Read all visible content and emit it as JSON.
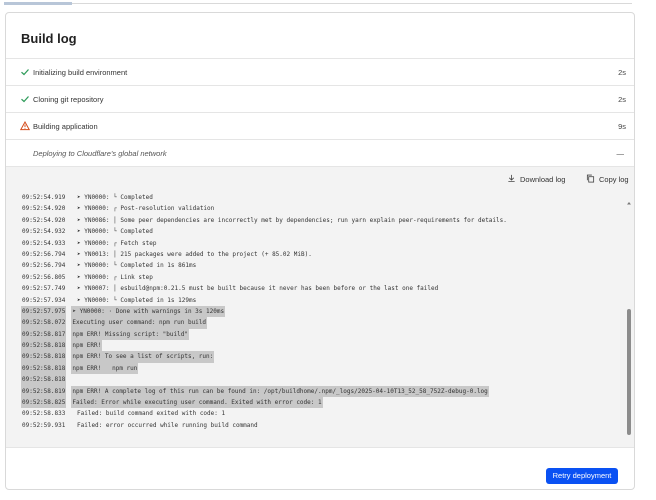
{
  "title": "Build log",
  "steps": [
    {
      "label": "Initializing build environment",
      "duration": "2s",
      "status": "success"
    },
    {
      "label": "Cloning git repository",
      "duration": "2s",
      "status": "success"
    },
    {
      "label": "Building application",
      "duration": "9s",
      "status": "warning"
    },
    {
      "label": "Deploying to Cloudflare's global network",
      "duration": "—",
      "status": "pending"
    }
  ],
  "toolbar": {
    "download_label": "Download log",
    "copy_label": "Copy log"
  },
  "log": [
    {
      "ts": "09:52:54.919",
      "msg": "➤ YN0000: └ Completed",
      "hl": false
    },
    {
      "ts": "09:52:54.920",
      "msg": "➤ YN0000: ┌ Post-resolution validation",
      "hl": false
    },
    {
      "ts": "09:52:54.920",
      "msg": "➤ YN0086: │ Some peer dependencies are incorrectly met by dependencies; run yarn explain peer-requirements for details.",
      "hl": false
    },
    {
      "ts": "09:52:54.932",
      "msg": "➤ YN0000: └ Completed",
      "hl": false
    },
    {
      "ts": "09:52:54.933",
      "msg": "➤ YN0000: ┌ Fetch step",
      "hl": false
    },
    {
      "ts": "09:52:56.794",
      "msg": "➤ YN0013: │ 215 packages were added to the project (+ 85.02 MiB).",
      "hl": false
    },
    {
      "ts": "09:52:56.794",
      "msg": "➤ YN0000: └ Completed in 1s 861ms",
      "hl": false
    },
    {
      "ts": "09:52:56.805",
      "msg": "➤ YN0000: ┌ Link step",
      "hl": false
    },
    {
      "ts": "09:52:57.749",
      "msg": "➤ YN0007: │ esbuild@npm:0.21.5 must be built because it never has been before or the last one failed",
      "hl": false
    },
    {
      "ts": "09:52:57.934",
      "msg": "➤ YN0000: └ Completed in 1s 129ms",
      "hl": false
    },
    {
      "ts": "09:52:57.975",
      "msg": "➤ YN0000: · Done with warnings in 3s 120ms",
      "hl": true
    },
    {
      "ts": "09:52:58.072",
      "msg": "Executing user command: npm run build",
      "hl": true
    },
    {
      "ts": "09:52:58.817",
      "msg": "npm ERR! Missing script: \"build\"",
      "hl": true
    },
    {
      "ts": "09:52:58.818",
      "msg": "npm ERR!",
      "hl": true
    },
    {
      "ts": "09:52:58.818",
      "msg": "npm ERR! To see a list of scripts, run:",
      "hl": true
    },
    {
      "ts": "09:52:58.818",
      "msg": "npm ERR!   npm run",
      "hl": true
    },
    {
      "ts": "09:52:58.818",
      "msg": "",
      "hl": true
    },
    {
      "ts": "09:52:58.819",
      "msg": "npm ERR! A complete log of this run can be found in: /opt/buildhome/.npm/_logs/2025-04-10T13_52_58_752Z-debug-0.log",
      "hl": true
    },
    {
      "ts": "09:52:58.825",
      "msg": "Failed: Error while executing user command. Exited with error code: 1",
      "hl": true
    },
    {
      "ts": "09:52:58.833",
      "msg": "Failed: build command exited with code: 1",
      "hl": false
    },
    {
      "ts": "09:52:59.931",
      "msg": "Failed: error occurred while running build command",
      "hl": false
    }
  ],
  "footer": {
    "retry_label": "Retry deployment"
  },
  "colors": {
    "accent": "#0a51f3",
    "success": "#2f9c5b",
    "warning": "#d44c1c"
  },
  "icons": {
    "success": "check-icon",
    "warning": "warning-triangle-icon",
    "download": "download-icon",
    "copy": "copy-icon"
  }
}
